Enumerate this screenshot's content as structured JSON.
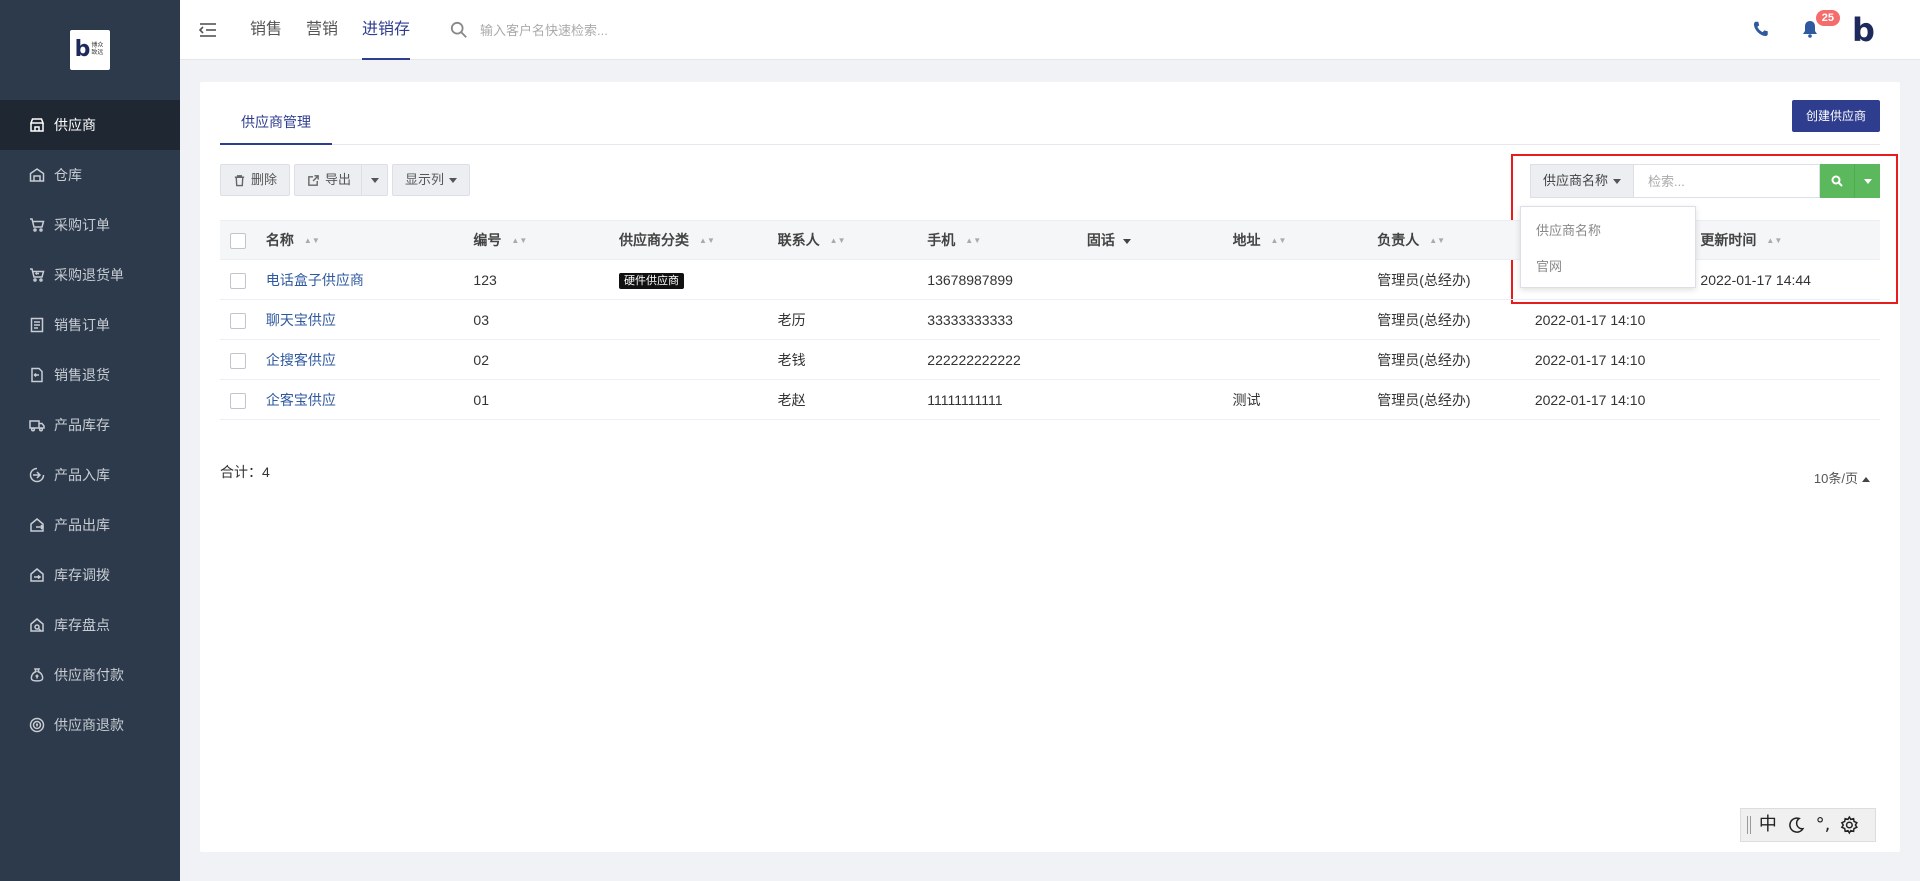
{
  "brand": {
    "logo_letter": "b",
    "logo_text": "博众致远"
  },
  "sidebar": {
    "items": [
      {
        "label": "供应商",
        "icon": "store-icon",
        "active": true
      },
      {
        "label": "仓库",
        "icon": "warehouse-icon"
      },
      {
        "label": "采购订单",
        "icon": "cart-icon"
      },
      {
        "label": "采购退货单",
        "icon": "cart-return-icon"
      },
      {
        "label": "销售订单",
        "icon": "list-icon"
      },
      {
        "label": "销售退货",
        "icon": "document-return-icon"
      },
      {
        "label": "产品库存",
        "icon": "truck-icon"
      },
      {
        "label": "产品入库",
        "icon": "inbound-icon"
      },
      {
        "label": "产品出库",
        "icon": "outbound-icon"
      },
      {
        "label": "库存调拨",
        "icon": "transfer-icon"
      },
      {
        "label": "库存盘点",
        "icon": "inventory-check-icon"
      },
      {
        "label": "供应商付款",
        "icon": "money-bag-icon"
      },
      {
        "label": "供应商退款",
        "icon": "refund-icon"
      }
    ]
  },
  "topbar": {
    "nav": [
      {
        "label": "销售",
        "active": false
      },
      {
        "label": "营销",
        "active": false
      },
      {
        "label": "进销存",
        "active": true
      }
    ],
    "search_placeholder": "输入客户名快速检索...",
    "notification_count": "25",
    "brand_letter": "b"
  },
  "page": {
    "tab": "供应商管理",
    "create_button": "创建供应商",
    "toolbar": {
      "delete": "删除",
      "export": "导出",
      "columns": "显示列"
    },
    "search": {
      "field_label": "供应商名称",
      "placeholder": "检索...",
      "options": [
        "供应商名称",
        "官网"
      ]
    },
    "table": {
      "headers": {
        "name": "名称",
        "code": "编号",
        "category": "供应商分类",
        "contact": "联系人",
        "mobile": "手机",
        "telephone": "固话",
        "address": "地址",
        "owner": "负责人",
        "updated": "更新时间"
      },
      "rows": [
        {
          "name": "电话盒子供应商",
          "code": "123",
          "category": "硬件供应商",
          "contact": "",
          "mobile": "13678987899",
          "telephone": "",
          "address": "",
          "owner": "管理员(总经办)",
          "created": "",
          "updated": "2022-01-17 14:44"
        },
        {
          "name": "聊天宝供应",
          "code": "03",
          "category": "",
          "contact": "老历",
          "mobile": "33333333333",
          "telephone": "",
          "address": "",
          "owner": "管理员(总经办)",
          "created": "2022-01-17 14:10",
          "updated": ""
        },
        {
          "name": "企搜客供应",
          "code": "02",
          "category": "",
          "contact": "老钱",
          "mobile": "222222222222",
          "telephone": "",
          "address": "",
          "owner": "管理员(总经办)",
          "created": "2022-01-17 14:10",
          "updated": ""
        },
        {
          "name": "企客宝供应",
          "code": "01",
          "category": "",
          "contact": "老赵",
          "mobile": "11111111111",
          "telephone": "",
          "address": "测试",
          "owner": "管理员(总经办)",
          "created": "2022-01-17 14:10",
          "updated": ""
        }
      ]
    },
    "total": "合计：4",
    "page_size": "10条/页"
  },
  "ime": {
    "lang": "中",
    "punct": "°,"
  },
  "colors": {
    "primary": "#2f3d8f",
    "sidebar_bg": "#2d3a4b",
    "search_button": "#5cb85c",
    "highlight": "#e81c1c",
    "badge": "#f56c6c"
  }
}
